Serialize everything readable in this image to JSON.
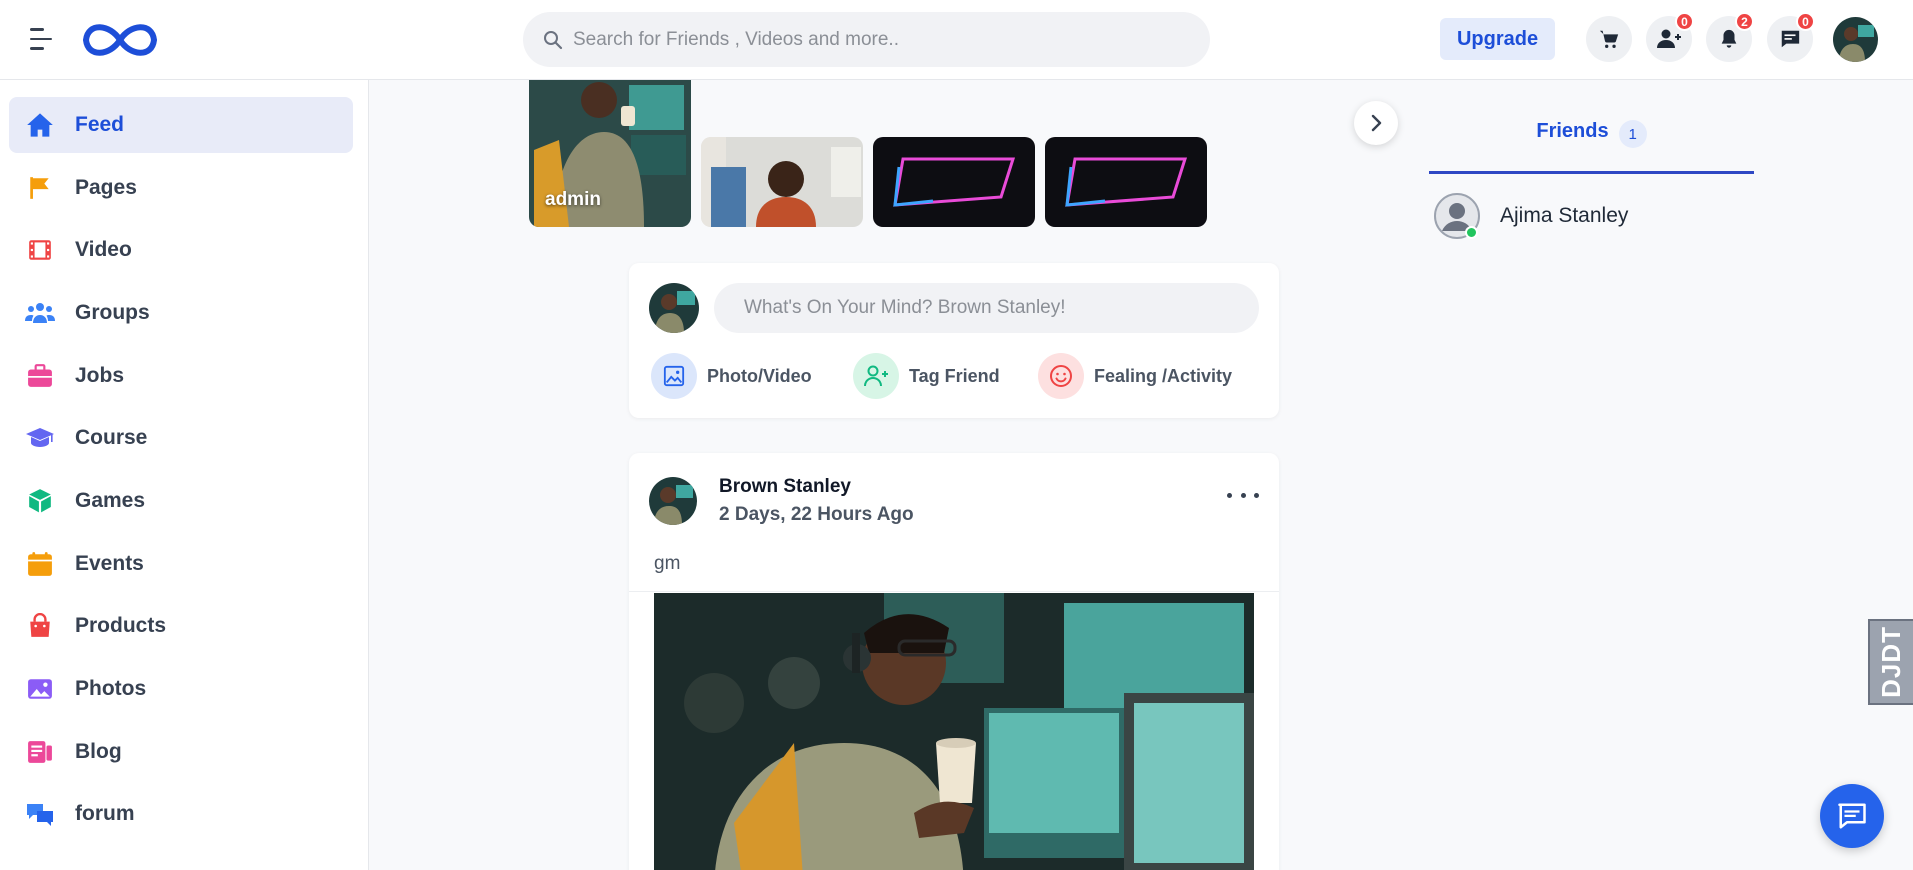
{
  "header": {
    "search_placeholder": "Search for Friends , Videos and more..",
    "upgrade_label": "Upgrade",
    "friend_requests_count": "0",
    "notifications_count": "2",
    "messages_count": "0"
  },
  "sidebar": {
    "items": [
      {
        "label": "Feed",
        "icon": "home-icon",
        "color": "#2563eb"
      },
      {
        "label": "Pages",
        "icon": "flag-icon",
        "color": "#f59e0b"
      },
      {
        "label": "Video",
        "icon": "film-icon",
        "color": "#ef4444"
      },
      {
        "label": "Groups",
        "icon": "users-icon",
        "color": "#3b82f6"
      },
      {
        "label": "Jobs",
        "icon": "briefcase-icon",
        "color": "#ec4899"
      },
      {
        "label": "Course",
        "icon": "graduation-cap-icon",
        "color": "#6366f1"
      },
      {
        "label": "Games",
        "icon": "cube-icon",
        "color": "#10b981"
      },
      {
        "label": "Events",
        "icon": "calendar-icon",
        "color": "#f59e0b"
      },
      {
        "label": "Products",
        "icon": "shopping-bag-icon",
        "color": "#ef4444"
      },
      {
        "label": "Photos",
        "icon": "image-icon",
        "color": "#8b5cf6"
      },
      {
        "label": "Blog",
        "icon": "blog-icon",
        "color": "#ec4899"
      },
      {
        "label": "forum",
        "icon": "chat-bubbles-icon",
        "color": "#3b82f6"
      }
    ]
  },
  "stories": [
    {
      "label": "admin"
    },
    {
      "label": ""
    },
    {
      "label": ""
    },
    {
      "label": ""
    }
  ],
  "composer": {
    "placeholder": "What's On Your Mind? Brown Stanley!",
    "actions": [
      {
        "label": "Photo/Video",
        "icon": "photo-icon"
      },
      {
        "label": "Tag Friend",
        "icon": "user-plus-icon"
      },
      {
        "label": "Fealing /Activity",
        "icon": "smile-icon"
      }
    ]
  },
  "post": {
    "author": "Brown Stanley",
    "time": "2 Days, 22 Hours Ago",
    "text": "gm"
  },
  "friends_panel": {
    "tab_label": "Friends",
    "count": "1",
    "friends": [
      {
        "name": "Ajima Stanley",
        "online": true
      }
    ]
  },
  "debug_tab_label": "DJDT"
}
